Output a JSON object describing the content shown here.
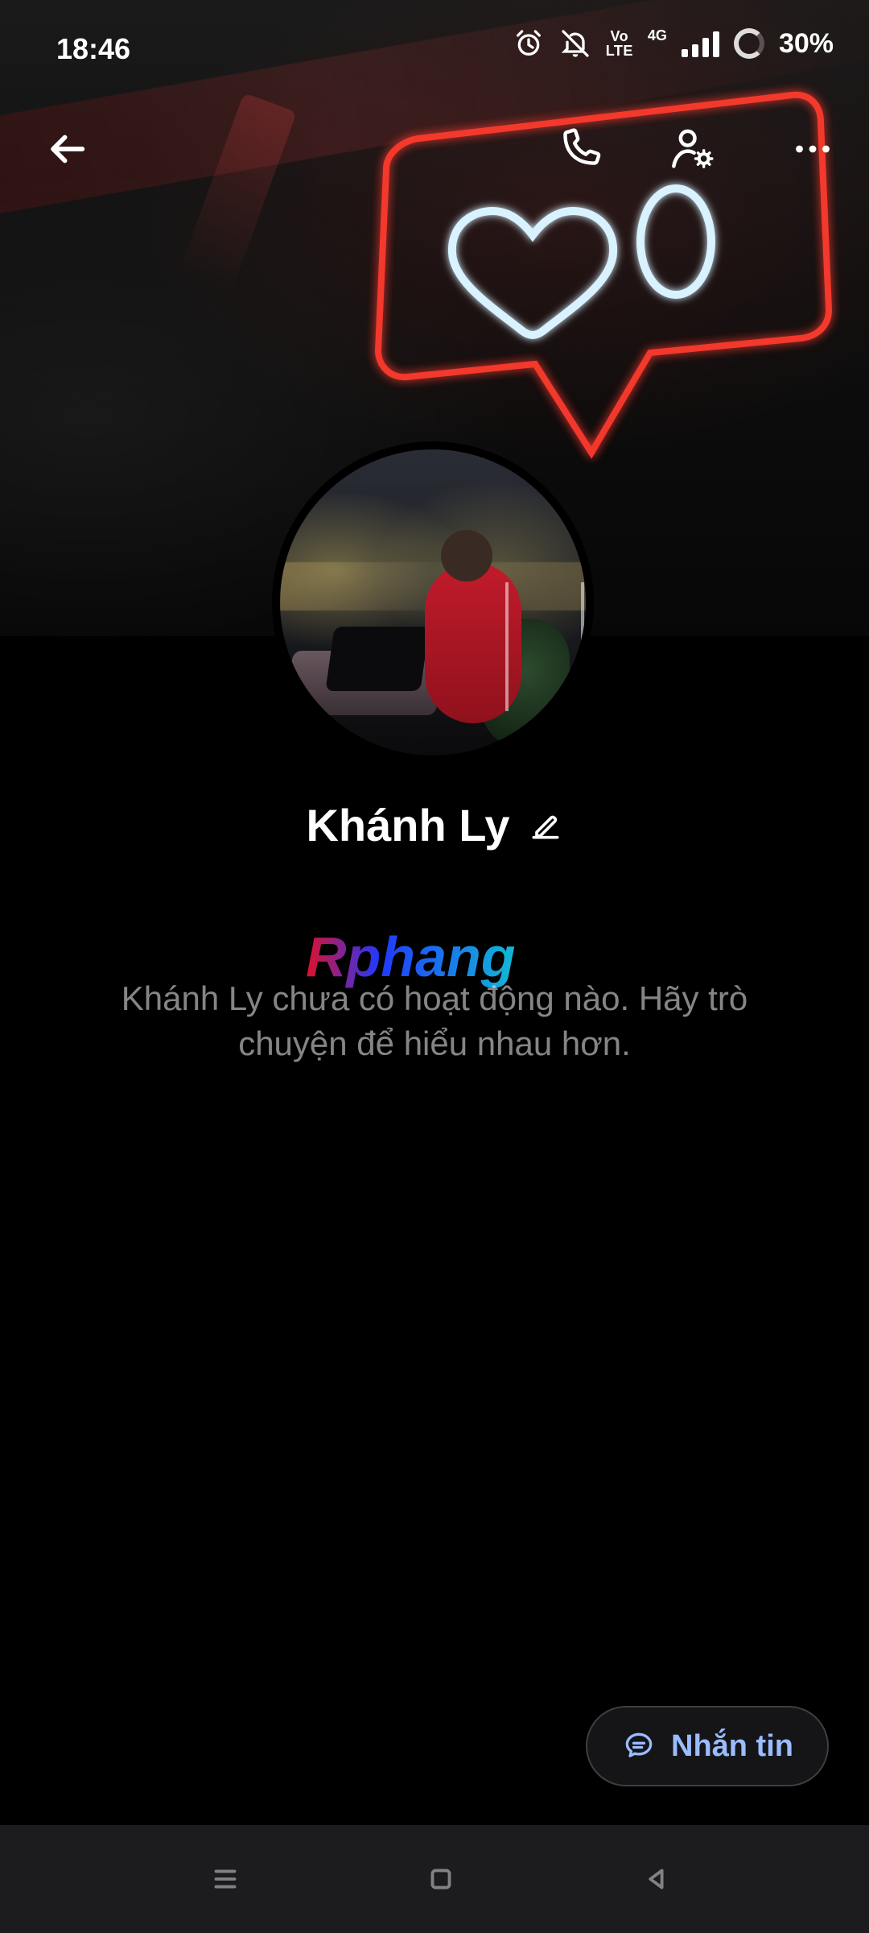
{
  "status_bar": {
    "time": "18:46",
    "battery": "30%",
    "network_text_top": "Vo",
    "network_text_bottom": "LTE",
    "data_type": "4G"
  },
  "top_actions": {
    "back_icon": "back-arrow-icon",
    "call_icon": "phone-icon",
    "user_settings_icon": "user-settings-icon",
    "more_icon": "more-horizontal-icon"
  },
  "profile": {
    "name": "Khánh Ly"
  },
  "watermark": {
    "text": "Rphang"
  },
  "empty_state": {
    "line1": "Khánh Ly chưa có hoạt động nào. Hãy trò",
    "line2": "chuyện để hiểu nhau hơn."
  },
  "chat_button": {
    "label": "Nhắn tin",
    "icon": "message-icon"
  },
  "nav": {
    "menu_icon": "menu-icon",
    "home_icon": "home-icon",
    "back_icon": "nav-back-icon"
  },
  "colors": {
    "accent": "#9bbcff"
  }
}
